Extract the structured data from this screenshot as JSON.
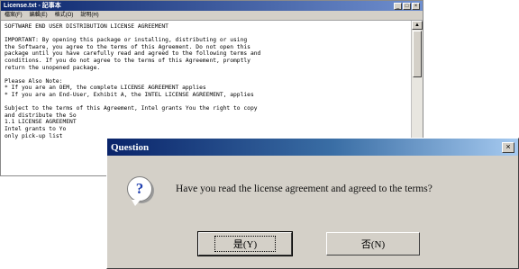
{
  "back_window": {
    "title": "License.txt - 記事本",
    "menu": [
      "檔案(F)",
      "編輯(E)",
      "格式(O)",
      "說明(H)"
    ],
    "lines": [
      "SOFTWARE END USER DISTRIBUTION LICENSE AGREEMENT",
      "",
      "IMPORTANT:  By opening this package or installing, distributing or using",
      "the Software, you agree to the terms of this Agreement.  Do not open this",
      "package until you have carefully read and agreed to the following terms and",
      "conditions.  If you do not agree to the terms of this Agreement, promptly",
      "return the unopened package.",
      "",
      "Please Also Note:",
      "* If you are an OEM, the complete LICENSE AGREEMENT applies",
      "* If you are an End-User, Exhibit A, the INTEL LICENSE AGREEMENT, applies",
      "",
      "Subject to the terms of this Agreement, Intel grants You the right to copy",
      "and distribute the So",
      "1.1     LICENSE AGREEMENT",
      "        Intel grants to Yo",
      "        only pick-up list"
    ]
  },
  "dialog": {
    "title": "Question",
    "message": "Have you read the license agreement and agreed to the terms?",
    "yes_label": "是(Y)",
    "no_label": "否(N)"
  }
}
